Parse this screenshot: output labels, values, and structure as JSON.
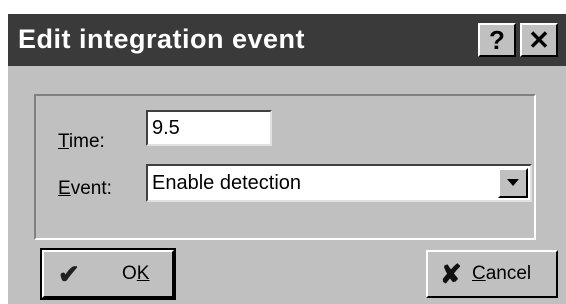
{
  "dialog": {
    "title": "Edit integration event",
    "help_glyph": "?",
    "close_glyph": "✕"
  },
  "form": {
    "time": {
      "label_mnemonic": "T",
      "label_rest": "ime:",
      "value": "9.5"
    },
    "event": {
      "label_mnemonic": "E",
      "label_rest": "vent:",
      "selected": "Enable detection"
    }
  },
  "buttons": {
    "ok": {
      "icon": "check-icon",
      "glyph": "✔",
      "label_pre": "O",
      "label_mnemonic": "K",
      "label_post": ""
    },
    "cancel": {
      "icon": "x-cross-icon",
      "glyph": "✘",
      "label_pre": "",
      "label_mnemonic": "C",
      "label_post": "ancel"
    }
  },
  "colors": {
    "titlebar": "#3a3a3a",
    "face": "#c0c0c0",
    "field_bg": "#ffffff"
  }
}
